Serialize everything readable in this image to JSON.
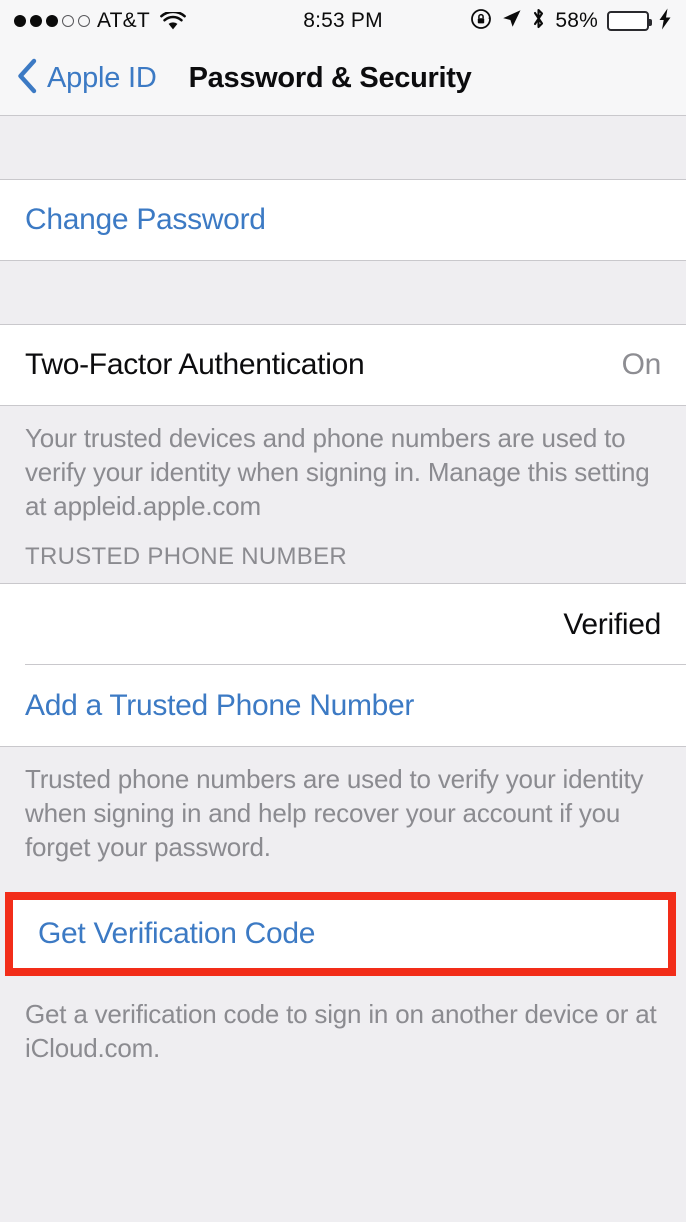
{
  "status_bar": {
    "signal_dots_filled": 3,
    "signal_dots_total": 5,
    "carrier": "AT&T",
    "wifi_icon": "wifi-icon",
    "time": "8:53 PM",
    "rotation_lock_icon": "rotation-lock-icon",
    "location_icon": "location-arrow-icon",
    "bluetooth_icon": "bluetooth-icon",
    "battery_percent": "58%",
    "battery_level": 58,
    "battery_color": "#4CD554",
    "charging_icon": "lightning-bolt-icon"
  },
  "nav": {
    "back_icon": "chevron-left-icon",
    "back_label": "Apple ID",
    "title": "Password & Security"
  },
  "sections": {
    "change_password": {
      "label": "Change Password"
    },
    "two_factor": {
      "label": "Two-Factor Authentication",
      "value": "On",
      "footer": "Your trusted devices and phone numbers are used to verify your identity when signing in. Manage this setting at appleid.apple.com"
    },
    "trusted_phone": {
      "header": "TRUSTED PHONE NUMBER",
      "number": "",
      "status": "Verified",
      "add_label": "Add a Trusted Phone Number",
      "footer": "Trusted phone numbers are used to verify your identity when signing in and help recover your account if you forget your password."
    },
    "verification_code": {
      "label": "Get Verification Code",
      "footer": "Get a verification code to sign in on another device or at iCloud.com."
    }
  },
  "annotation": {
    "target": "Get Verification Code",
    "color": "#F22D19"
  },
  "colors": {
    "accent_blue": "#3C7AC4",
    "background_gray": "#EFEEF1",
    "row_white": "#FFFFFF",
    "secondary_text": "#8B8B90"
  }
}
